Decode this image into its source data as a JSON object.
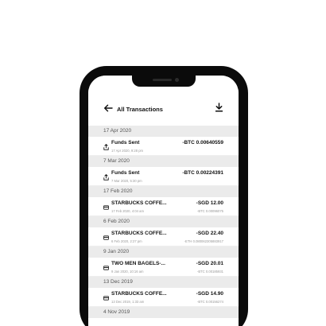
{
  "header": {
    "title": "All Transactions"
  },
  "groups": [
    {
      "date": "17 Apr 2020",
      "txn": {
        "type": "send",
        "name": "Funds Sent",
        "datetime": "17 Apr 2020, 9:28 pm",
        "amount": "-BTC 0.00640559",
        "sub": ""
      }
    },
    {
      "date": "7 Mar 2020",
      "txn": {
        "type": "send",
        "name": "Funds Sent",
        "datetime": "7 Mar 2020, 5:30 pm",
        "amount": "-BTC 0.00224391",
        "sub": ""
      }
    },
    {
      "date": "17 Feb 2020",
      "txn": {
        "type": "card",
        "name": "STARBUCKS COFFE...",
        "datetime": "17 Feb 2020, 4:04 am",
        "amount": "-SGD 12.00",
        "sub": "-BTC 0.00096075"
      }
    },
    {
      "date": "6 Feb 2020",
      "txn": {
        "type": "card",
        "name": "STARBUCKS COFFE...",
        "datetime": "6 Feb 2020, 2:27 pm",
        "amount": "-SGD 22.40",
        "sub": "-ETH 0.080062305883917"
      }
    },
    {
      "date": "9 Jan 2020",
      "txn": {
        "type": "card",
        "name": "TWO MEN BAGELS-...",
        "datetime": "9 Jan 2020, 10:16 am",
        "amount": "-SGD 20.01",
        "sub": "-BTC 0.00185931"
      }
    },
    {
      "date": "13 Dec 2019",
      "txn": {
        "type": "card",
        "name": "STARBUCKS COFFE...",
        "datetime": "13 Dec 2019, 1:33 am",
        "amount": "-SGD 14.90",
        "sub": "-BTC 0.00156274"
      }
    },
    {
      "date": "4 Nov 2019",
      "txn": null
    }
  ],
  "icons": {
    "back": "arrow-left-icon",
    "download": "download-icon",
    "send": "share-upload-icon",
    "card": "credit-card-icon"
  },
  "colors": {
    "phone_frame": "#0b0b0b",
    "date_header_bg": "#ebebeb",
    "text_primary": "#111111",
    "text_secondary": "#9a9a9a"
  }
}
